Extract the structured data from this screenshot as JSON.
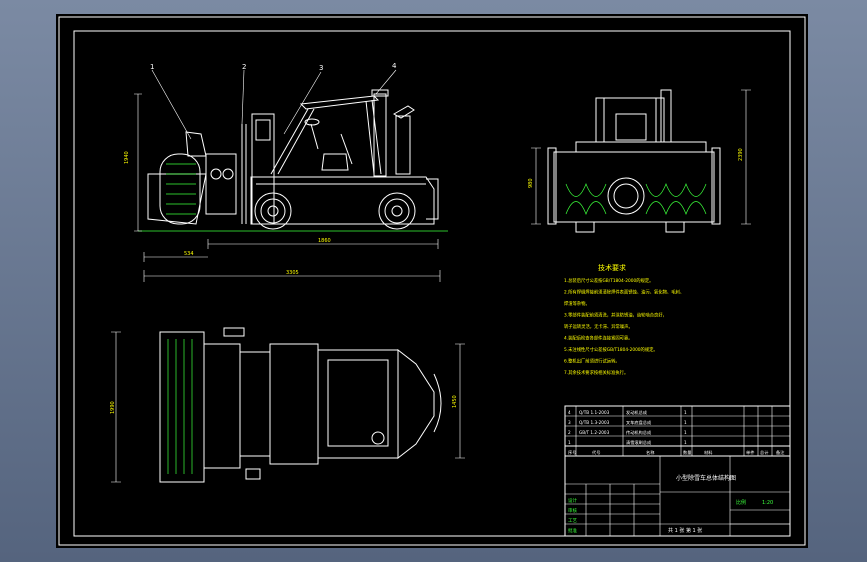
{
  "drawing": {
    "callouts": [
      "1",
      "2",
      "3",
      "4"
    ],
    "dimensions": {
      "front_height": "1940",
      "overall_length_inner": "1860",
      "front_offset": "534",
      "overall_length": "3305",
      "side_height_total": "2390",
      "side_height_lower": "980",
      "plan_width": "1990",
      "plan_width_inner": "1450"
    },
    "notes": {
      "title": "技术要求",
      "lines": [
        "1.总装后尺寸公差按GB/T1804-2000的规定。",
        "2.所有焊缝焊接前须清除焊件表面锈蚀、油污、氧化物、毛刺、",
        "   焊渣等杂物。",
        "3.零部件装配前须清洗，并涂防锈油，齿轮啮合良好，",
        "   转子运转灵活，无卡滞、异常噪声。",
        "4.装配后检查各部件连接紧固可靠。",
        "5.未注线性尺寸公差按GB/T1804-2000的规定。",
        "6.整机出厂前须进行试运转。",
        "7.其余技术要求按相关标准执行。"
      ]
    },
    "bom": [
      [
        "4",
        "Q/TB 1.1-2003",
        "发动机总成",
        "1",
        "",
        ""
      ],
      [
        "3",
        "Q/TB 1.3-2003",
        "叉车底盘总成",
        "1",
        "",
        ""
      ],
      [
        "2",
        "GB/T 1.2-2003",
        "传动机构总成",
        "1",
        "",
        ""
      ],
      [
        "1",
        "",
        "清雪滚刷总成",
        "1",
        "",
        ""
      ]
    ],
    "bom_header": [
      "序号",
      "代号",
      "名称",
      "数量",
      "材料",
      "单件",
      "总计",
      "备注"
    ],
    "title_block": {
      "drawing_title": "小型除雪车总体结构图",
      "scale_label": "比例",
      "scale_value": "1:20",
      "sheet_info": "共 1 张  第 1 张",
      "rows": [
        "设计",
        "审核",
        "工艺",
        "批准"
      ]
    }
  }
}
